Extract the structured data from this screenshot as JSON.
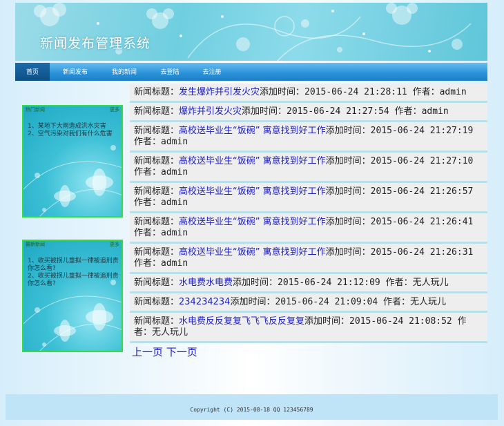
{
  "site": {
    "title": "新闻发布管理系统"
  },
  "nav": [
    {
      "label": "首页",
      "active": true
    },
    {
      "label": "新闻发布"
    },
    {
      "label": "我的新闻"
    },
    {
      "label": "去登陆"
    },
    {
      "label": "去注册"
    }
  ],
  "sidebar": {
    "box1": {
      "head_left": "热门新闻",
      "head_right": "更多",
      "items": [
        "1、某地下大雨造成洪水灾害",
        "2、空气污染对我们有什么危害"
      ]
    },
    "box2": {
      "head_left": "最新新闻",
      "head_right": "更多",
      "items": [
        "1、收买被拐儿童拟一律被追刑责 你怎么看?",
        "2、收买被拐儿童拟一律被追刑责 你怎么看?"
      ]
    }
  },
  "labels": {
    "title": "新闻标题：",
    "time": "添加时间：",
    "author": "作者："
  },
  "news": [
    {
      "title": "发生爆炸并引发火灾",
      "time": "2015-06-24 21:28:11",
      "author": "admin"
    },
    {
      "title": "爆炸并引发火灾",
      "time": "2015-06-24 21:27:54",
      "author": "admin"
    },
    {
      "title": "高校送毕业生“饭碗” 寓意找到好工作",
      "time": "2015-06-24 21:27:19",
      "author": "admin"
    },
    {
      "title": "高校送毕业生“饭碗” 寓意找到好工作",
      "time": "2015-06-24 21:27:10",
      "author": "admin"
    },
    {
      "title": "高校送毕业生“饭碗” 寓意找到好工作",
      "time": "2015-06-24 21:26:57",
      "author": "admin"
    },
    {
      "title": "高校送毕业生“饭碗” 寓意找到好工作",
      "time": "2015-06-24 21:26:41",
      "author": "admin"
    },
    {
      "title": "高校送毕业生“饭碗” 寓意找到好工作",
      "time": "2015-06-24 21:26:31",
      "author": "admin"
    },
    {
      "title": "水电费水电费",
      "time": "2015-06-24 21:12:09",
      "author": "无人玩儿"
    },
    {
      "title": "234234234",
      "time": "2015-06-24 21:09:04",
      "author": "无人玩儿"
    },
    {
      "title": "水电费反反复复飞飞飞反反复复",
      "time": "2015-06-24 21:08:52",
      "author": "无人玩儿"
    }
  ],
  "pager": {
    "prev": "上一页",
    "next": "下一页"
  },
  "footer": {
    "text": "Copyright (C) 2015-08-18  QQ 123456789"
  }
}
